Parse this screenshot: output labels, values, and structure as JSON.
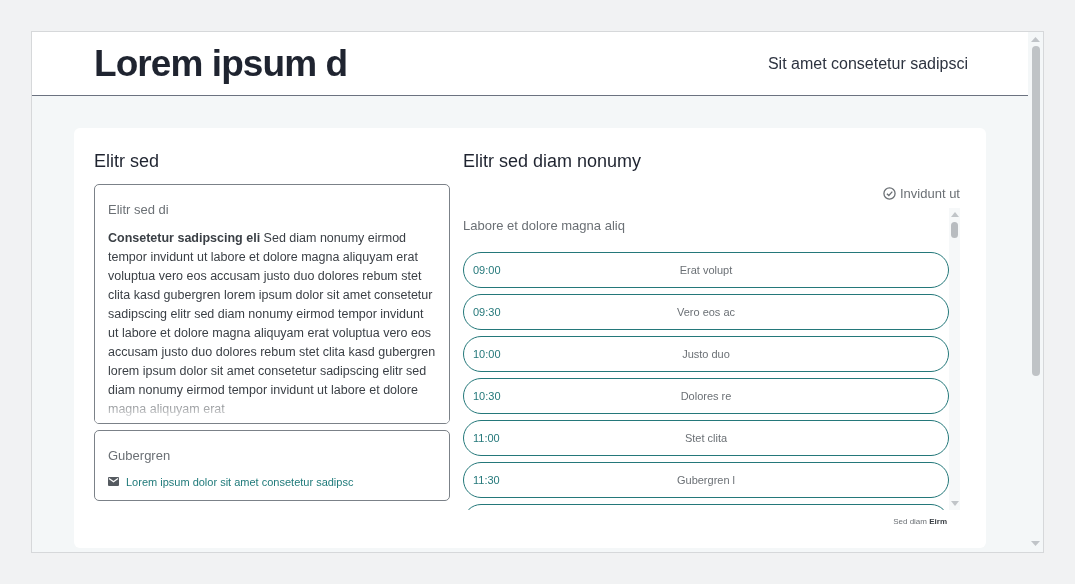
{
  "header": {
    "title": "Lorem ipsum d",
    "tagline": "Sit amet consetetur sadipsci"
  },
  "left": {
    "heading": "Elitr sed",
    "text_card": {
      "label": "Elitr sed di",
      "body": "**Consetetur sadipscing eli** Sed diam nonumy eirmod tempor invidunt ut labore et dolore magna aliquyam erat voluptua vero eos accusam justo duo dolores rebum stet clita kasd gubergren lorem ipsum dolor sit amet consetetur sadipscing elitr sed diam nonumy eirmod tempor invidunt ut labore et dolore magna aliquyam erat voluptua vero eos accusam justo duo dolores rebum stet clita kasd gubergren lorem ipsum dolor sit amet consetetur sadipscing elitr sed diam nonumy eirmod tempor invidunt ut labore et dolore magna aliquyam erat"
    },
    "contact_card": {
      "label": "Gubergren",
      "email": "Lorem ipsum dolor sit amet consetetur sadipsc"
    }
  },
  "right": {
    "heading": "Elitr sed diam nonumy",
    "status": "Invidunt ut",
    "list_label": "Labore et dolore magna aliq",
    "slots": [
      {
        "time": "09:00",
        "title": "Erat volupt"
      },
      {
        "time": "09:30",
        "title": "Vero eos ac"
      },
      {
        "time": "10:00",
        "title": "Justo duo"
      },
      {
        "time": "10:30",
        "title": "Dolores re"
      },
      {
        "time": "11:00",
        "title": "Stet clita"
      },
      {
        "time": "11:30",
        "title": "Gubergren l"
      }
    ],
    "footer": "Sed diam **Eirm**"
  }
}
